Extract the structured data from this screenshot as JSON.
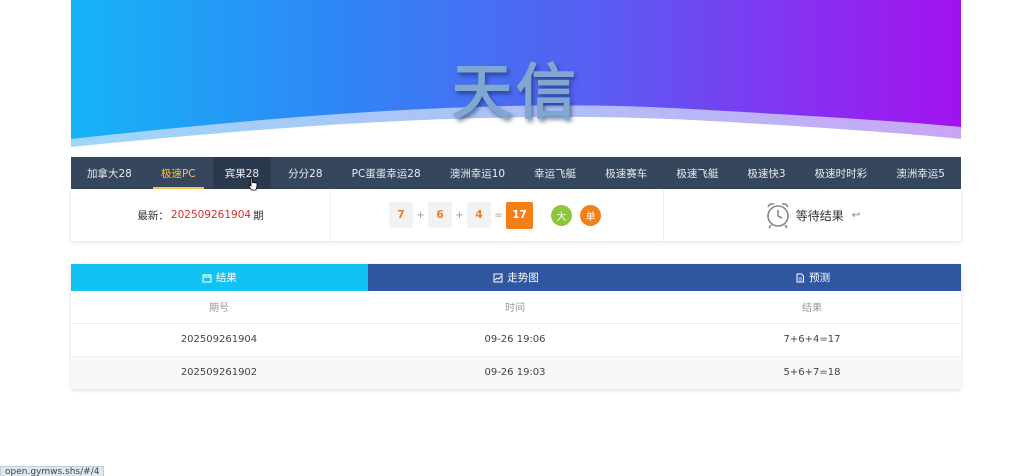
{
  "banner": {
    "title": "天信"
  },
  "nav": {
    "items": [
      {
        "label": "加拿大28"
      },
      {
        "label": "极速PC",
        "active": true
      },
      {
        "label": "宾果28"
      },
      {
        "label": "分分28"
      },
      {
        "label": "PC蛋蛋幸运28"
      },
      {
        "label": "澳洲幸运10"
      },
      {
        "label": "幸运飞艇"
      },
      {
        "label": "极速赛车"
      },
      {
        "label": "极速飞艇"
      },
      {
        "label": "极速快3"
      },
      {
        "label": "极速时时彩"
      },
      {
        "label": "澳洲幸运5"
      }
    ]
  },
  "latest": {
    "prefix": "最新：",
    "issue": "202509261904",
    "suffix": "期",
    "balls": [
      "7",
      "6",
      "4"
    ],
    "plus": "+",
    "equals": "=",
    "sum": "17",
    "tag_big": "大",
    "tag_odd": "单",
    "status": "等待结果",
    "arrow": "↩"
  },
  "tabs": {
    "results": "结果",
    "trend": "走势图",
    "predict": "预测"
  },
  "table": {
    "headers": [
      "期号",
      "时间",
      "结果"
    ],
    "rows": [
      [
        "202509261904",
        "09-26 19:06",
        "7+6+4=17"
      ],
      [
        "202509261902",
        "09-26 19:03",
        "5+6+7=18"
      ]
    ]
  },
  "status_bar": {
    "url": "open.gymws.shs/#/4"
  },
  "colors": {
    "nav_bg": "#36465d",
    "nav_active": "#f5c24b",
    "tab_active": "#12c2f3",
    "tab_inactive": "#2f57a0",
    "issue_red": "#d62d2d",
    "orange": "#f57e15",
    "green": "#8cc63f"
  }
}
